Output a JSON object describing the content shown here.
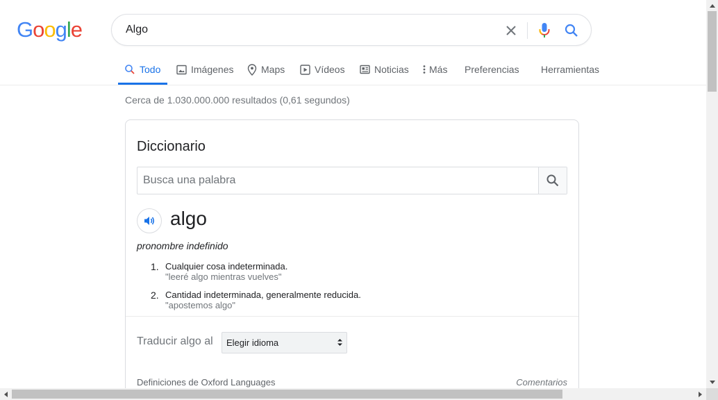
{
  "logo": {
    "letters": [
      "G",
      "o",
      "o",
      "g",
      "l",
      "e"
    ],
    "colors": [
      "#4285f4",
      "#ea4335",
      "#fbbc05",
      "#4285f4",
      "#34a853",
      "#ea4335"
    ]
  },
  "search": {
    "query": "Algo"
  },
  "tabs": [
    {
      "label": "Todo",
      "icon": "search-icon",
      "active": true
    },
    {
      "label": "Imágenes",
      "icon": "image-icon"
    },
    {
      "label": "Maps",
      "icon": "map-pin-icon"
    },
    {
      "label": "Vídeos",
      "icon": "play-icon"
    },
    {
      "label": "Noticias",
      "icon": "news-icon"
    },
    {
      "label": "Más",
      "icon": "more-vert-icon"
    },
    {
      "label": "Preferencias"
    },
    {
      "label": "Herramientas"
    }
  ],
  "result_stats": "Cerca de 1.030.000.000 resultados (0,61 segundos)",
  "dictionary": {
    "title": "Diccionario",
    "search_placeholder": "Busca una palabra",
    "headword": "algo",
    "part_of_speech": "pronombre indefinido",
    "definitions": [
      {
        "num": "1.",
        "text": "Cualquier cosa indeterminada.",
        "example": "\"leeré algo mientras vuelves\""
      },
      {
        "num": "2.",
        "text": "Cantidad indeterminada, generalmente reducida.",
        "example": "\"apostemos algo\""
      }
    ],
    "translate_label": "Traducir algo al",
    "language_select": "Elegir idioma",
    "source": "Definiciones de Oxford Languages",
    "comments": "Comentarios"
  },
  "colors": {
    "accent": "#1a73e8",
    "text_secondary": "#70757a"
  }
}
